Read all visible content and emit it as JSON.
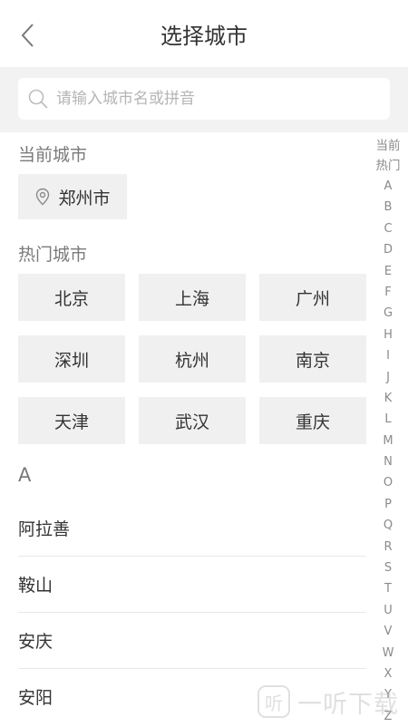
{
  "header": {
    "title": "选择城市",
    "back_icon": "chevron-left-icon"
  },
  "search": {
    "placeholder": "请输入城市名或拼音",
    "value": "",
    "icon": "search-icon"
  },
  "current": {
    "label": "当前城市",
    "city": "郑州市",
    "icon": "location-pin-icon"
  },
  "hot": {
    "label": "热门城市",
    "cities": [
      "北京",
      "上海",
      "广州",
      "深圳",
      "杭州",
      "南京",
      "天津",
      "武汉",
      "重庆"
    ]
  },
  "group": {
    "letter": "A",
    "cities": [
      "阿拉善",
      "鞍山",
      "安庆",
      "安阳"
    ]
  },
  "index": {
    "top1": "当前",
    "top2": "热门",
    "letters": [
      "A",
      "B",
      "C",
      "D",
      "E",
      "F",
      "G",
      "H",
      "I",
      "J",
      "K",
      "L",
      "M",
      "N",
      "O",
      "P",
      "Q",
      "R",
      "S",
      "T",
      "U",
      "V",
      "W",
      "X",
      "Y",
      "Z"
    ]
  },
  "watermark": {
    "logo": "听",
    "text": "一听下载"
  }
}
